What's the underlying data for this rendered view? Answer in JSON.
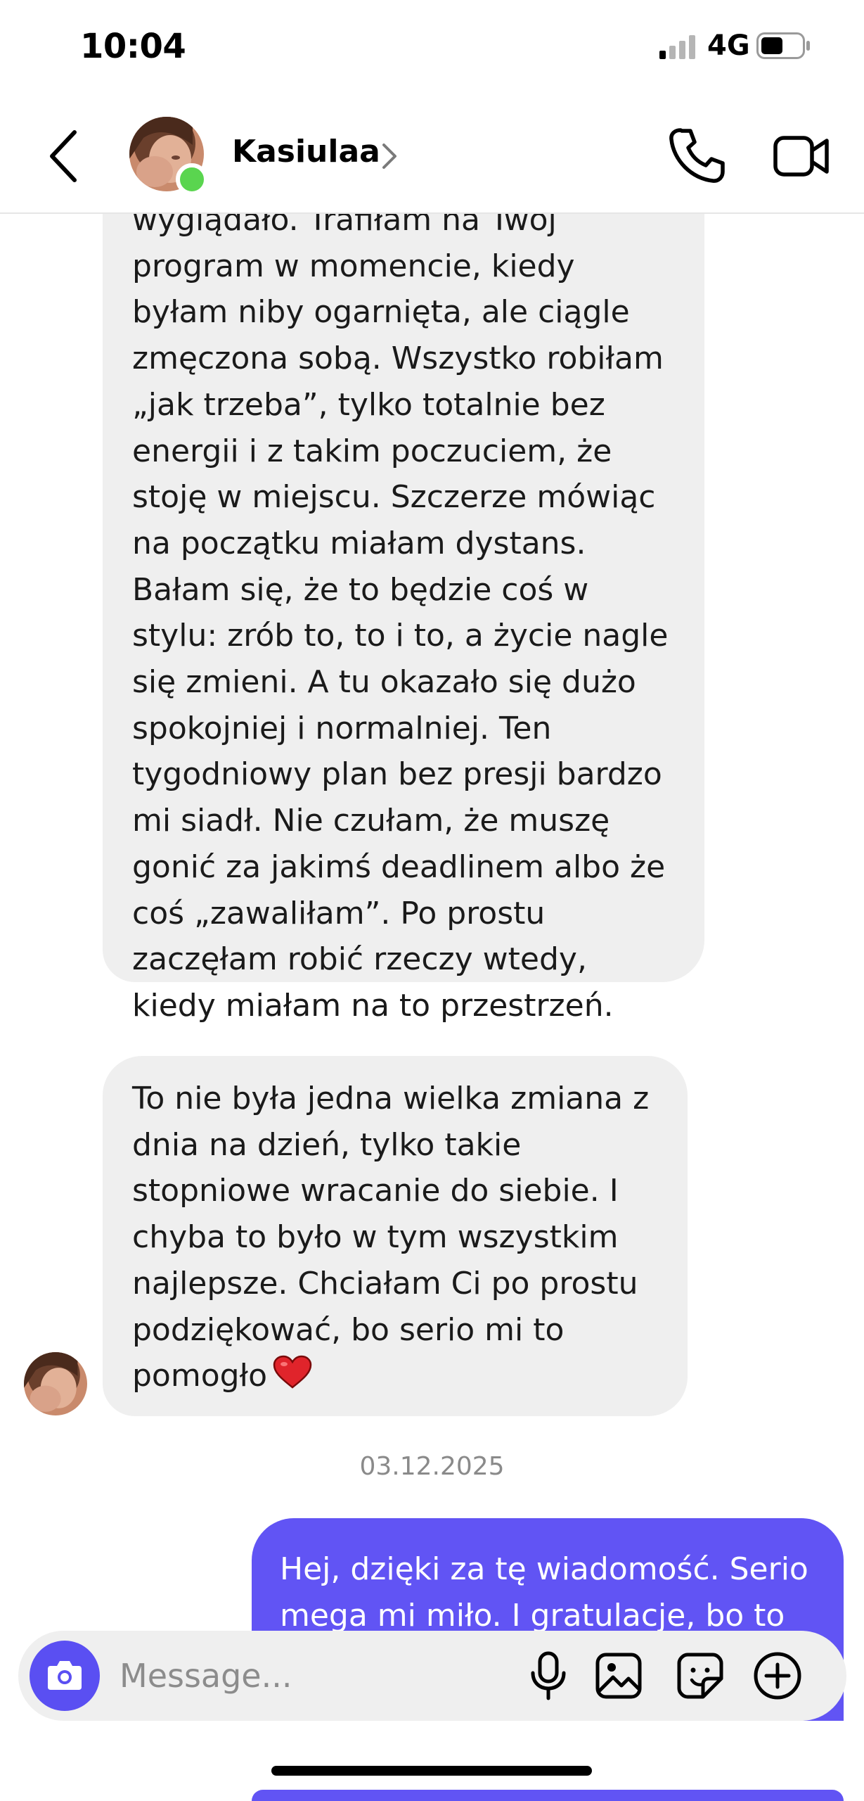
{
  "status_bar": {
    "time": "10:04",
    "network": "4G",
    "signal_icon": "signal-icon",
    "battery_icon": "battery-icon"
  },
  "header": {
    "contact_name": "Kasiulaa",
    "online": true,
    "back_icon": "chevron-left-icon",
    "call_icon": "phone-icon",
    "video_icon": "video-camera-icon"
  },
  "messages": {
    "incoming_1": {
      "lines": [
        "wyglądało. Trafiłam na Twój",
        "program w momencie, kiedy",
        "byłam niby ogarnięta, ale ciągle",
        "zmęczona sobą. Wszystko robiłam",
        "„jak trzeba”, tylko totalnie bez",
        "energii i z takim poczuciem, że",
        "stoję w miejscu. Szczerze mówiąc",
        "na początku miałam dystans.",
        "Bałam się, że to będzie coś w",
        "stylu: zrób to, to i to, a życie nagle",
        "się zmieni. A tu okazało się dużo",
        "spokojniej i normalniej. Ten",
        "tygodniowy plan bez presji bardzo",
        "mi siadł. Nie czułam, że muszę",
        "gonić za jakimś deadlinem albo że",
        "coś „zawaliłam”. Po prostu",
        "zaczęłam robić rzeczy wtedy,",
        "kiedy miałam na to przestrzeń."
      ]
    },
    "incoming_2": {
      "lines": [
        "To nie była jedna wielka zmiana z",
        "dnia na dzień, tylko takie",
        "stopniowe wracanie do siebie. I",
        "chyba to było w tym wszystkim",
        "najlepsze. Chciałam Ci po prostu",
        "podziękować, bo serio mi to",
        "pomogło"
      ],
      "emoji": "heart-emoji"
    },
    "date_separator": "03.12.2025",
    "outgoing_1": {
      "lines": [
        "Hej, dzięki za tę wiadomość. Serio",
        "mega mi miło. I gratulacje, bo to"
      ]
    }
  },
  "composer": {
    "placeholder": "Message...",
    "camera_icon": "camera-icon",
    "mic_icon": "microphone-icon",
    "gallery_icon": "image-icon",
    "sticker_icon": "sticker-icon",
    "plus_icon": "plus-circle-icon"
  },
  "colors": {
    "accent": "#6154f4",
    "incoming_bubble": "#efefef",
    "online": "#5ad54f"
  }
}
